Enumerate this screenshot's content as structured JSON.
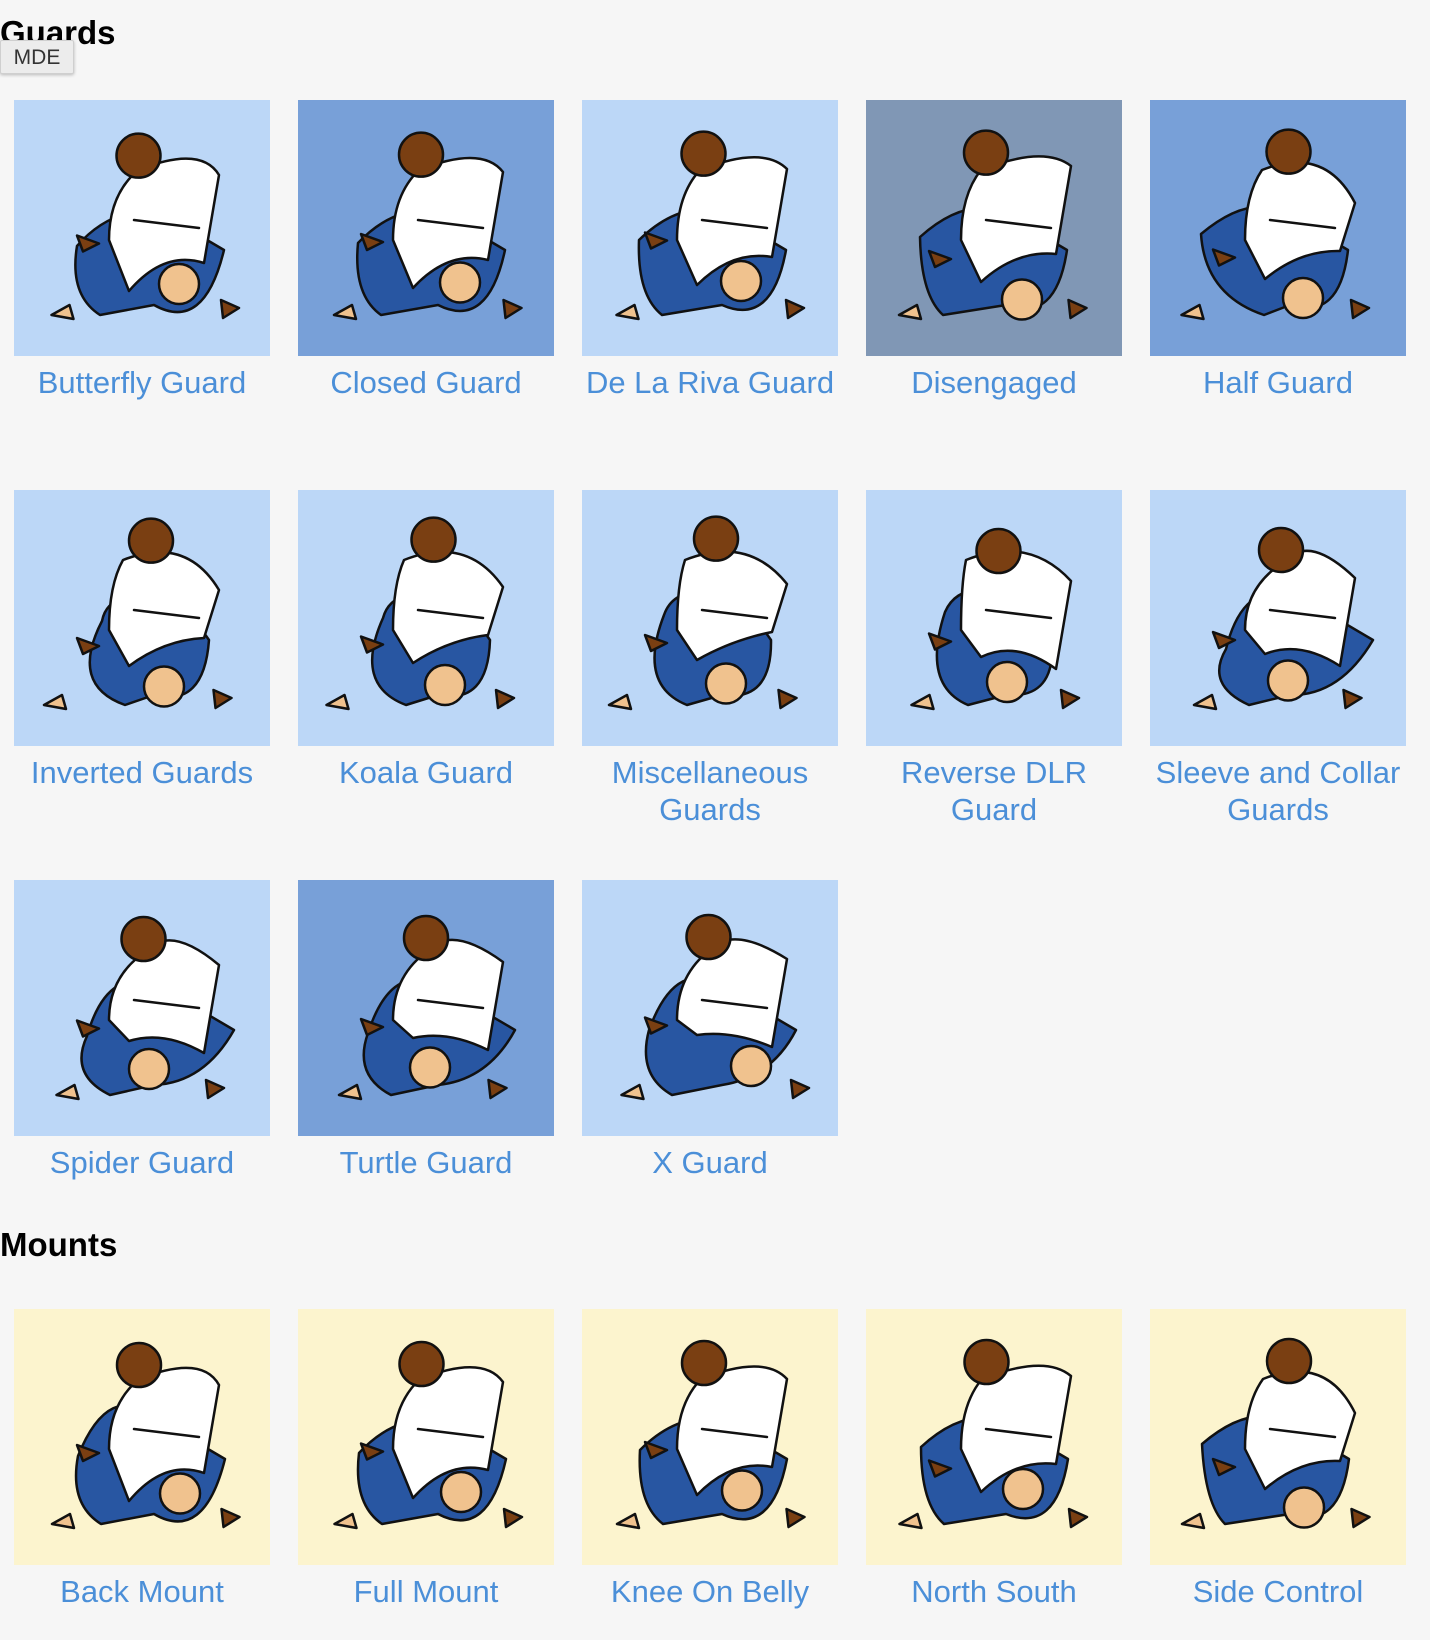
{
  "badge": "MDE",
  "colors": {
    "tile_light": "#bcd7f7",
    "tile_medium": "#78a0d8",
    "tile_gray": "#8097b5",
    "tile_cream": "#fcf4ce",
    "link": "#4b8fd8",
    "gi_blue": "#2856a2",
    "gi_white": "#ffffff",
    "skin_dark": "#7a3f12",
    "skin_light": "#f0c28e"
  },
  "sections": [
    {
      "title": "Guards",
      "items": [
        {
          "label": "Butterfly Guard",
          "bg": "tile_light"
        },
        {
          "label": "Closed Guard",
          "bg": "tile_medium"
        },
        {
          "label": "De La Riva Guard",
          "bg": "tile_light"
        },
        {
          "label": "Disengaged",
          "bg": "tile_gray"
        },
        {
          "label": "Half Guard",
          "bg": "tile_medium"
        },
        {
          "label": "Inverted Guards",
          "bg": "tile_light"
        },
        {
          "label": "Koala Guard",
          "bg": "tile_light"
        },
        {
          "label": "Miscellaneous Guards",
          "bg": "tile_light"
        },
        {
          "label": "Reverse DLR Guard",
          "bg": "tile_light"
        },
        {
          "label": "Sleeve and Collar Guards",
          "bg": "tile_light"
        },
        {
          "label": "Spider Guard",
          "bg": "tile_light"
        },
        {
          "label": "Turtle Guard",
          "bg": "tile_medium"
        },
        {
          "label": "X Guard",
          "bg": "tile_light"
        }
      ]
    },
    {
      "title": "Mounts",
      "items": [
        {
          "label": "Back Mount",
          "bg": "tile_cream"
        },
        {
          "label": "Full Mount",
          "bg": "tile_cream"
        },
        {
          "label": "Knee On Belly",
          "bg": "tile_cream"
        },
        {
          "label": "North South",
          "bg": "tile_cream"
        },
        {
          "label": "Side Control",
          "bg": "tile_cream"
        }
      ]
    }
  ]
}
